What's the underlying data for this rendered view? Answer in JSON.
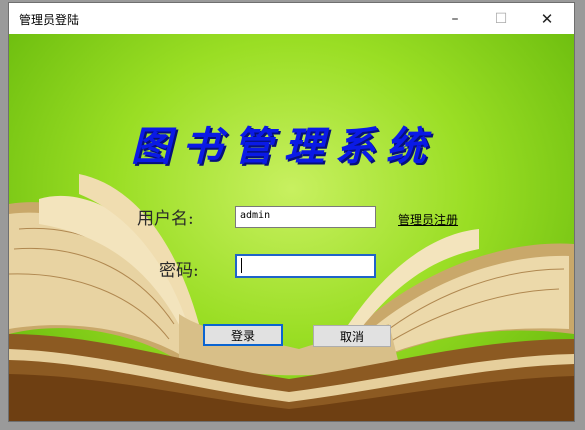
{
  "window": {
    "title": "管理员登陆",
    "minimize_glyph": "–",
    "maximize_glyph": "☐",
    "close_glyph": "✕"
  },
  "app": {
    "title": "图书管理系统"
  },
  "form": {
    "username_label": "用户名:",
    "username_value": "admin",
    "password_label": "密码:",
    "password_value": "",
    "register_link": "管理员注册",
    "login_button": "登录",
    "cancel_button": "取消"
  },
  "colors": {
    "title_blue": "#0a1ae6",
    "background_green": "#9ade24",
    "focus_border": "#1f63c9"
  }
}
